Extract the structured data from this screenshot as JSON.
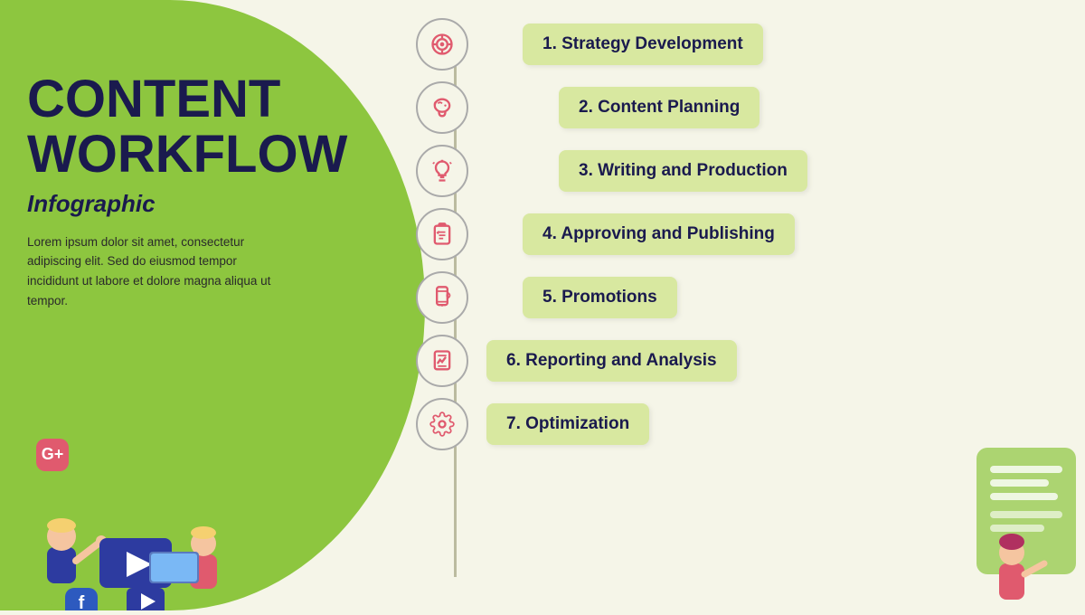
{
  "title": {
    "main": "CONTENT\nWORKFLOW",
    "line1": "CONTENT",
    "line2": "WORKFLOW",
    "subtitle": "Infographic",
    "description": "Lorem ipsum dolor sit amet, consectetur adipiscing elit. Sed do eiusmod tempor incididunt ut labore et dolore magna aliqua ut tempor."
  },
  "steps": [
    {
      "id": 1,
      "label": "1. Strategy Development",
      "icon": "target"
    },
    {
      "id": 2,
      "label": "2. Content Planning",
      "icon": "brain"
    },
    {
      "id": 3,
      "label": "3. Writing and Production",
      "icon": "lightbulb"
    },
    {
      "id": 4,
      "label": "4. Approving and Publishing",
      "icon": "clipboard"
    },
    {
      "id": 5,
      "label": "5. Promotions",
      "icon": "mobile"
    },
    {
      "id": 6,
      "label": "6. Reporting and Analysis",
      "icon": "chart"
    },
    {
      "id": 7,
      "label": "7. Optimization",
      "icon": "settings"
    }
  ],
  "colors": {
    "left_bg": "#8dc63f",
    "right_bg": "#f5f5e8",
    "step_box": "#d8e8a0",
    "title_color": "#1a1a4e",
    "accent": "#e05a6e"
  }
}
